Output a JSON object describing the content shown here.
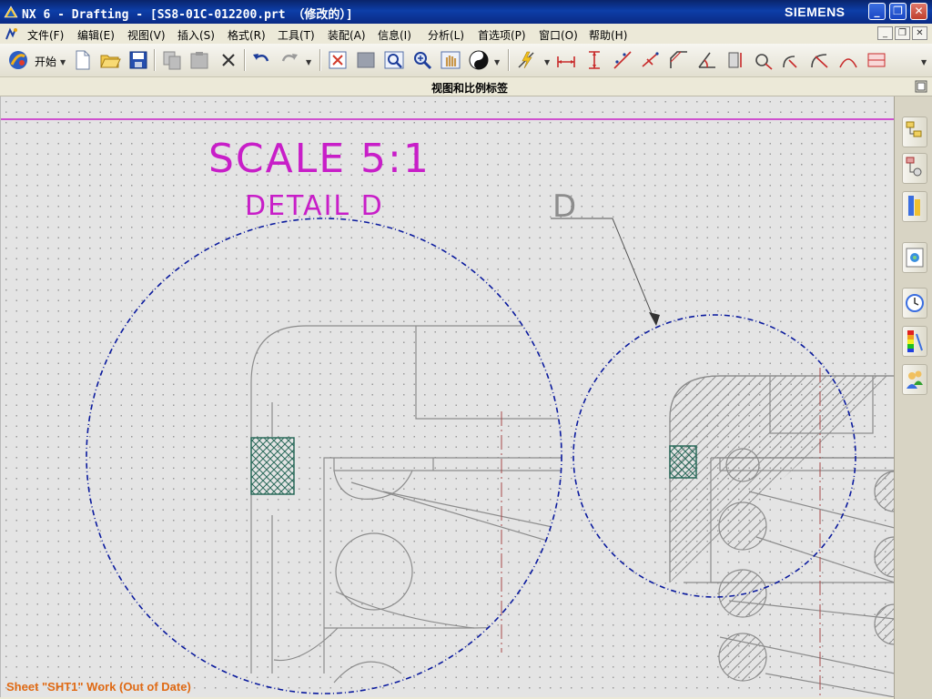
{
  "window": {
    "title": "NX 6 - Drafting - [SS8-01C-012200.prt （修改的）]",
    "brand": "SIEMENS",
    "buttons": [
      "minimize",
      "restore",
      "close"
    ]
  },
  "menubar": {
    "items": [
      {
        "label": "文件(F)"
      },
      {
        "label": "编辑(E)"
      },
      {
        "label": "视图(V)"
      },
      {
        "label": "插入(S)"
      },
      {
        "label": "格式(R)"
      },
      {
        "label": "工具(T)"
      },
      {
        "label": "装配(A)"
      },
      {
        "label": "信息(I)"
      },
      {
        "label": "分析(L)"
      },
      {
        "label": "首选项(P)"
      },
      {
        "label": "窗口(O)"
      },
      {
        "label": "帮助(H)"
      }
    ]
  },
  "toolbar": {
    "start_label": "开始",
    "icons": [
      "start-icon",
      "new-file-icon",
      "open-folder-icon",
      "save-icon",
      "copy-icon",
      "paste-icon",
      "delete-icon",
      "undo-icon",
      "redo-icon",
      "fit-view-icon",
      "zoom-window-icon",
      "zoom-box-icon",
      "zoom-in-out-icon",
      "pan-hand-icon",
      "render-style-icon",
      "lightning-icon",
      "horizontal-dim-icon",
      "vertical-dim-icon",
      "parallel-dim-icon",
      "perpendicular-dim-icon",
      "chamfer-dim-icon",
      "angle-dim-icon",
      "cylinder-dim-icon",
      "hole-dim-icon",
      "radius-dim-icon",
      "radius-center-dim-icon",
      "arc-dim-icon",
      "ordinate-dim-icon"
    ]
  },
  "bar2": {
    "label": "视图和比例标签"
  },
  "drawing": {
    "scale_text": "SCALE 5:1",
    "detail_text": "DETAIL D",
    "label_letter": "D"
  },
  "colors": {
    "annotation": "#c81ec8",
    "circle": "#0a1a9e",
    "geometry": "#8c8c8c",
    "centerline": "#a84848",
    "seal": "#2a6a5a",
    "status": "#e06a14",
    "canvas_bg": "#e4e4e4"
  },
  "right_panel": {
    "icons": [
      "assembly-navigator-icon",
      "part-navigator-icon",
      "roles-icon",
      "web-browser-icon",
      "history-icon",
      "color-palette-icon",
      "system-roles-icon"
    ]
  },
  "status": {
    "text": "Sheet \"SHT1\" Work (Out of Date)"
  }
}
